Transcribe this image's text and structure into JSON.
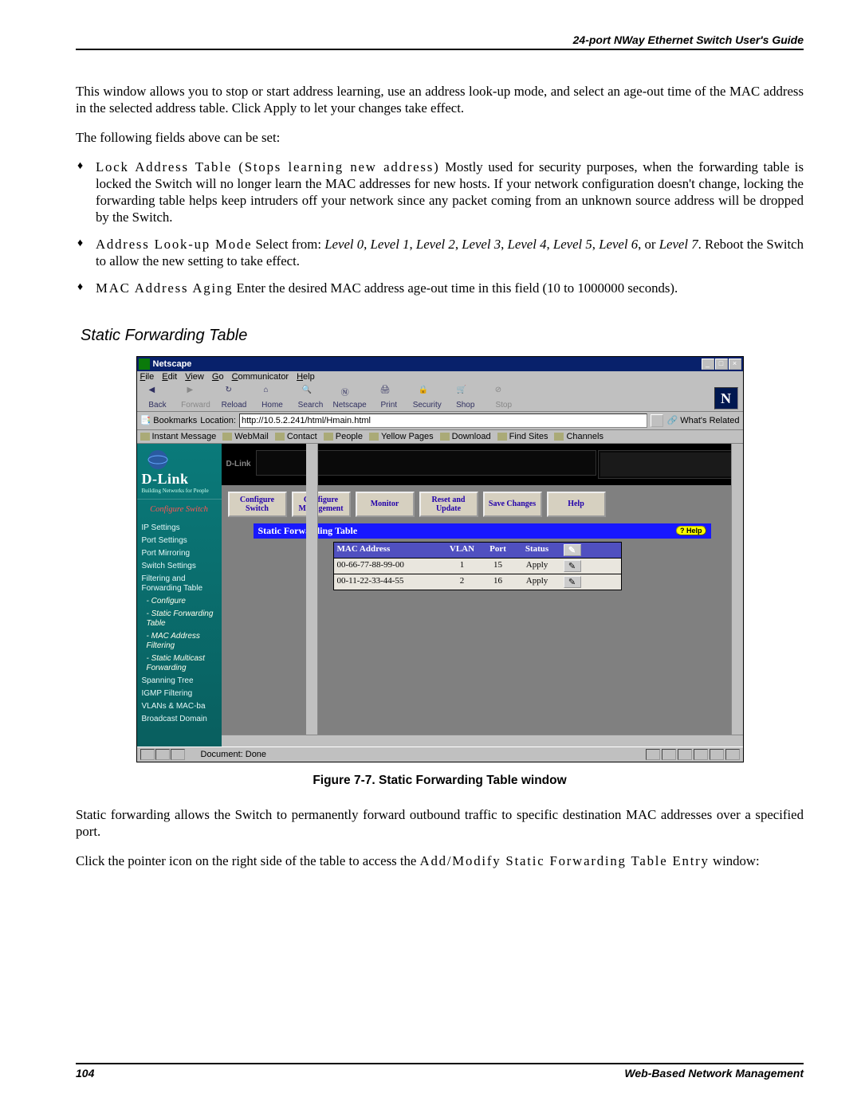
{
  "header": {
    "title": "24-port NWay Ethernet Switch User's Guide"
  },
  "intro": {
    "p1": "This window allows you to stop or start address learning, use an address look-up mode, and select an age-out time of the MAC address in the selected address table. Click Apply to let your changes take effect.",
    "p2": "The following fields above can be set:"
  },
  "bullets": {
    "b1_head": "Lock Address Table (Stops learning new address)",
    "b1_body": "  Mostly used for security purposes, when the forwarding table is locked the Switch will no longer learn the MAC addresses for new hosts. If your network configuration doesn't change, locking the forwarding table helps keep intruders off your network since any packet coming from an unknown source address will be dropped by the Switch.",
    "b2_head": "Address Look-up Mode",
    "b2_lead": "  Select from: ",
    "b2_levels": [
      "Level 0",
      "Level 1",
      "Level 2",
      "Level 3",
      "Level 4",
      "Level 5",
      "Level 6",
      "Level 7"
    ],
    "b2_tail": ". Reboot the Switch to allow the new setting to take effect.",
    "b3_head": "MAC Address Aging",
    "b3_body": "  Enter the desired MAC address age-out time in this field (10 to 1000000 seconds)."
  },
  "section_title": "Static Forwarding Table",
  "browser": {
    "title": "Netscape",
    "menus": [
      "File",
      "Edit",
      "View",
      "Go",
      "Communicator",
      "Help"
    ],
    "toolbar": [
      {
        "label": "Back",
        "dis": false
      },
      {
        "label": "Forward",
        "dis": true
      },
      {
        "label": "Reload",
        "dis": false
      },
      {
        "label": "Home",
        "dis": false
      },
      {
        "label": "Search",
        "dis": false
      },
      {
        "label": "Netscape",
        "dis": false
      },
      {
        "label": "Print",
        "dis": false
      },
      {
        "label": "Security",
        "dis": false
      },
      {
        "label": "Shop",
        "dis": false
      },
      {
        "label": "Stop",
        "dis": true
      }
    ],
    "bookmarks_label": "Bookmarks",
    "location_label": "Location:",
    "location_value": "http://10.5.2.241/html/Hmain.html",
    "whats_related": "What's Related",
    "personal_toolbar": [
      "Instant Message",
      "WebMail",
      "Contact",
      "People",
      "Yellow Pages",
      "Download",
      "Find Sites",
      "Channels"
    ],
    "status_text": "Document: Done"
  },
  "device": {
    "brand": "D-Link",
    "tag": "Building Networks for People"
  },
  "sidebar_config": {
    "label": "Configure Switch"
  },
  "sidebar": [
    {
      "label": "IP Settings",
      "cls": "plain"
    },
    {
      "label": "Port Settings",
      "cls": "plain"
    },
    {
      "label": "Port Mirroring",
      "cls": "plain"
    },
    {
      "label": "Switch Settings",
      "cls": "plain"
    },
    {
      "label": "Filtering and Forwarding Table",
      "cls": "plain"
    },
    {
      "label": "- Configure",
      "cls": "hi sub1"
    },
    {
      "label": "- Static Forwarding Table",
      "cls": "hi sub1"
    },
    {
      "label": "- MAC Address Filtering",
      "cls": "hi sub1"
    },
    {
      "label": "- Static Multicast Forwarding",
      "cls": "hi sub1"
    },
    {
      "label": "Spanning Tree",
      "cls": "plain"
    },
    {
      "label": "IGMP Filtering",
      "cls": "plain"
    },
    {
      "label": "VLANs & MAC-ba",
      "cls": "plain"
    },
    {
      "label": "Broadcast Domain",
      "cls": "plain"
    }
  ],
  "nav_buttons": [
    "Configure Switch",
    "Configure Management",
    "Monitor",
    "Reset and Update",
    "Save Changes",
    "Help"
  ],
  "panel": {
    "title": "Static Forwarding Table",
    "help": "Help",
    "columns": [
      "MAC Address",
      "VLAN",
      "Port",
      "Status",
      ""
    ],
    "rows": [
      {
        "mac": "00-66-77-88-99-00",
        "vlan": "1",
        "port": "15",
        "status": "Apply"
      },
      {
        "mac": "00-11-22-33-44-55",
        "vlan": "2",
        "port": "16",
        "status": "Apply"
      }
    ]
  },
  "figure_caption": "Figure 7-7.  Static Forwarding Table window",
  "after": {
    "p1": "Static forwarding allows the Switch to permanently forward outbound traffic to specific destination MAC addresses over a specified port.",
    "p2_a": "Click the pointer icon on the right side of the table to access the ",
    "p2_b": "Add/Modify Static Forwarding Table Entry",
    "p2_c": " window:"
  },
  "footer": {
    "page": "104",
    "section": "Web-Based Network Management"
  }
}
